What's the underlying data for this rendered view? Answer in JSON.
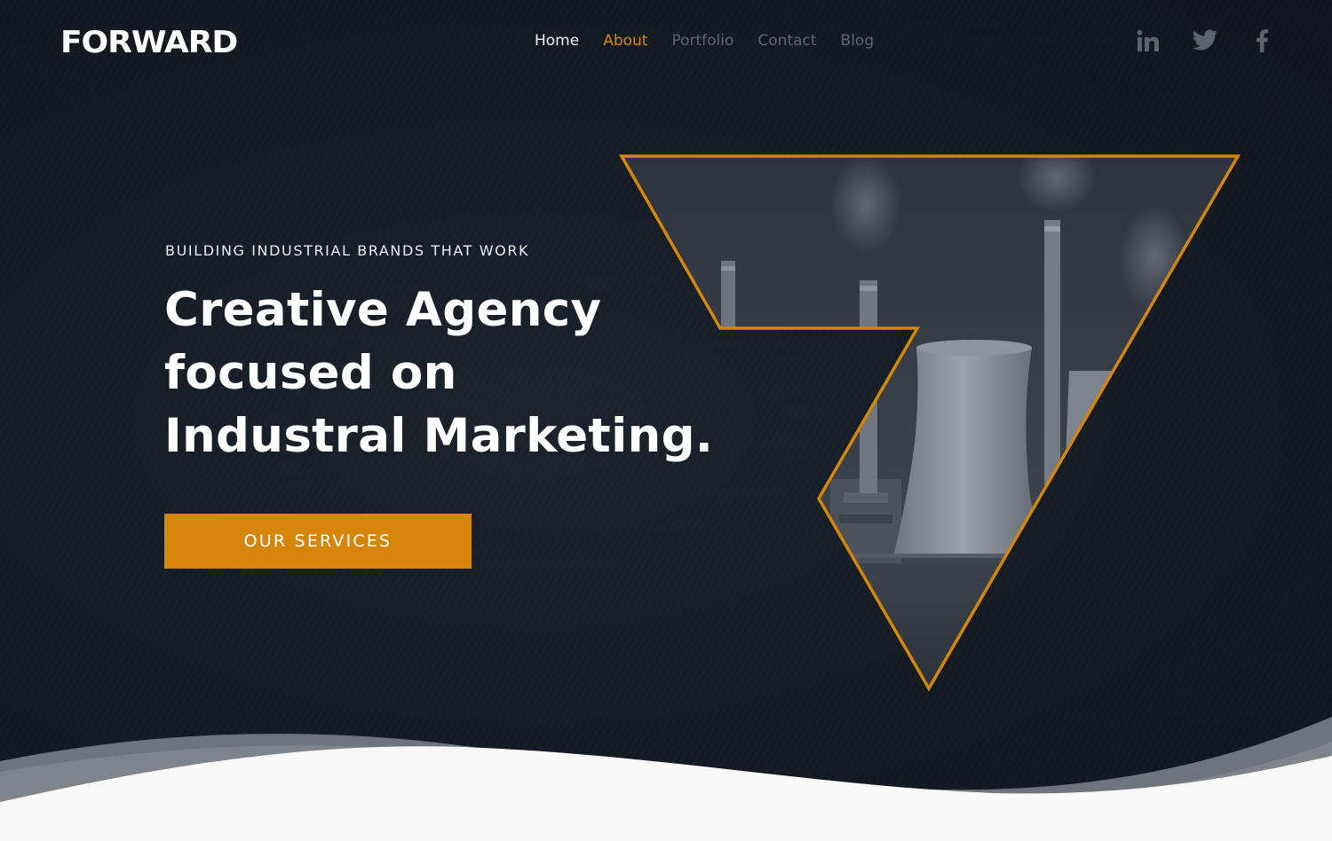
{
  "header": {
    "logo": "FORWARD",
    "nav": [
      {
        "label": "Home",
        "state": "default"
      },
      {
        "label": "About",
        "state": "active"
      },
      {
        "label": "Portfolio",
        "state": "muted"
      },
      {
        "label": "Contact",
        "state": "muted"
      },
      {
        "label": "Blog",
        "state": "muted"
      }
    ],
    "social": [
      {
        "icon": "linkedin-icon"
      },
      {
        "icon": "twitter-icon"
      },
      {
        "icon": "facebook-icon"
      }
    ]
  },
  "hero": {
    "eyebrow": "BUILDING INDUSTRIAL BRANDS THAT WORK",
    "headline_lines": [
      "Creative Agency",
      "focused on",
      "Industral Marketing."
    ],
    "cta_label": "OUR SERVICES",
    "graphic": "industrial-plant-image-in-seven-shaped-frame"
  },
  "colors": {
    "accent": "#d4860a",
    "background": "#161c24",
    "nav_active": "#d4860a",
    "nav_muted": "#5f6670",
    "text": "#ffffff",
    "wave_light": "#f8f8f8",
    "wave_shadow": "#6f737a"
  }
}
